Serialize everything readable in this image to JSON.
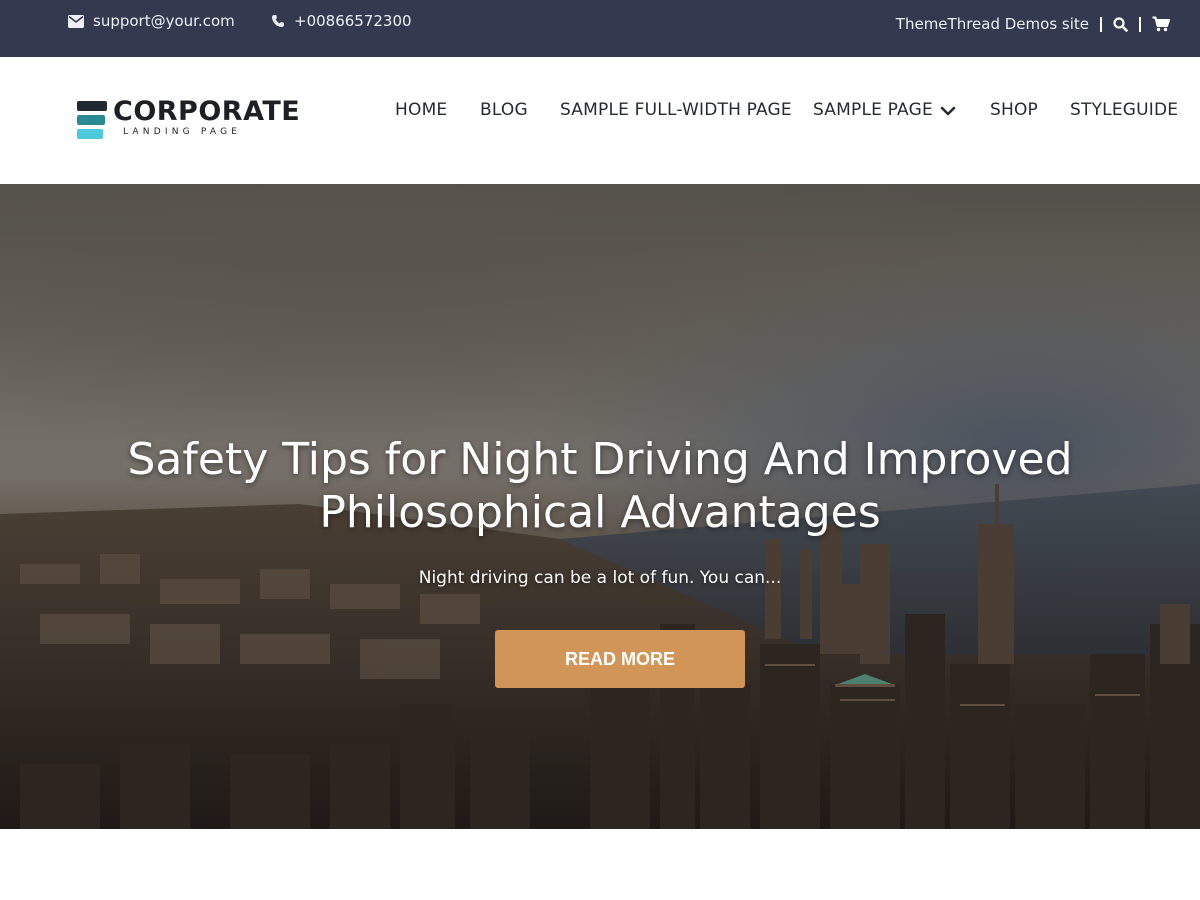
{
  "topbar": {
    "email": "support@your.com",
    "phone": "+00866572300",
    "demos_link": "ThemeThread Demos site",
    "icons": {
      "email": "envelope-icon",
      "phone": "phone-icon",
      "search": "search-icon",
      "cart": "cart-icon"
    }
  },
  "brand": {
    "title": "CORPORATE",
    "subtitle": "LANDING PAGE",
    "colors": [
      "#1f2a33",
      "#2a8a93",
      "#4cc9dc"
    ]
  },
  "nav": {
    "items": [
      {
        "label": "HOME"
      },
      {
        "label": "BLOG"
      },
      {
        "label": "SAMPLE FULL-WIDTH PAGE"
      },
      {
        "label": "SAMPLE PAGE",
        "has_dropdown": true
      },
      {
        "label": "SHOP"
      },
      {
        "label": "STYLEGUIDE"
      }
    ]
  },
  "hero": {
    "title_line1": "Safety Tips for Night Driving And Improved",
    "title_line2": "Philosophical Advantages",
    "excerpt": "Night driving can be a lot of fun. You can...",
    "button_label": "READ MORE",
    "button_color": "#d19657"
  },
  "colors": {
    "topbar_bg": "#333a4f",
    "nav_text": "#262a33"
  }
}
